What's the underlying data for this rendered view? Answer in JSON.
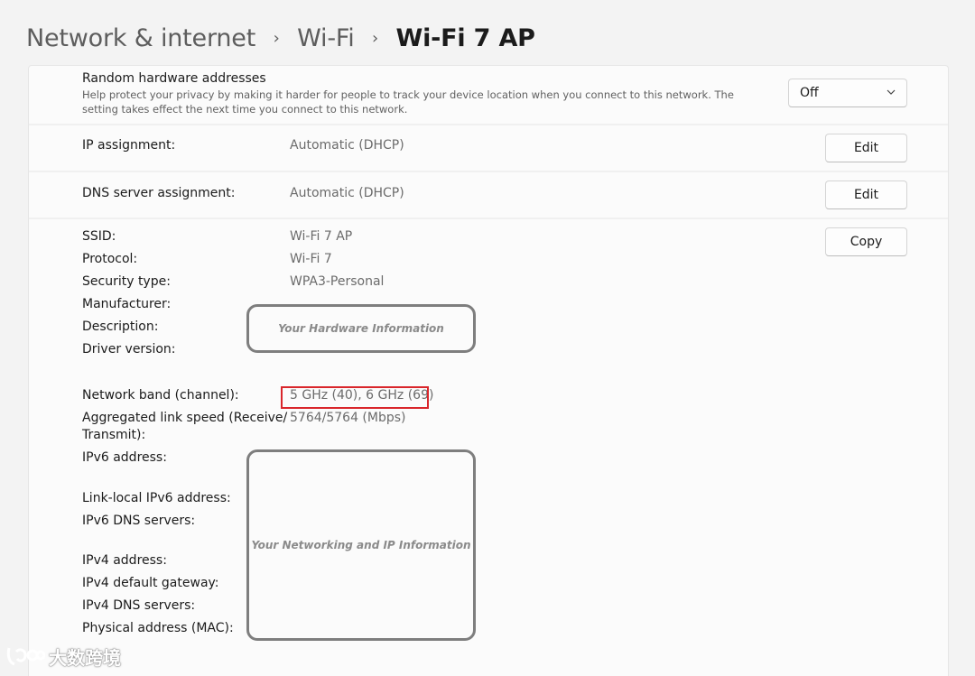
{
  "breadcrumb": {
    "items": [
      "Network & internet",
      "Wi-Fi",
      "Wi-Fi 7 AP"
    ],
    "separator": "›"
  },
  "random_hw": {
    "title": "Random hardware addresses",
    "description": "Help protect your privacy by making it harder for people to track your device location when you connect to this network. The setting takes effect the next time you connect to this network.",
    "selected": "Off",
    "icon": "chevron-down-icon"
  },
  "ip_assignment": {
    "label": "IP assignment:",
    "value": "Automatic (DHCP)",
    "button": "Edit"
  },
  "dns_assignment": {
    "label": "DNS server assignment:",
    "value": "Automatic (DHCP)",
    "button": "Edit"
  },
  "properties": {
    "copy_button": "Copy",
    "ssid": {
      "label": "SSID:",
      "value": "Wi-Fi 7 AP"
    },
    "protocol": {
      "label": "Protocol:",
      "value": "Wi-Fi 7"
    },
    "security": {
      "label": "Security type:",
      "value": "WPA3-Personal"
    },
    "manufacturer": {
      "label": "Manufacturer:"
    },
    "description": {
      "label": "Description:"
    },
    "driver": {
      "label": "Driver version:"
    },
    "band": {
      "label": "Network band (channel):",
      "value": "5 GHz (40), 6 GHz (69)"
    },
    "link_speed": {
      "label_line1": "Aggregated link speed (Receive/",
      "label_line2": "Transmit):",
      "value": "5764/5764 (Mbps)"
    },
    "ipv6": {
      "label": "IPv6 address:"
    },
    "link_local": {
      "label": "Link-local IPv6 address:"
    },
    "ipv6_dns": {
      "label": "IPv6 DNS servers:"
    },
    "ipv4": {
      "label": "IPv4 address:"
    },
    "ipv4_gateway": {
      "label": "IPv4 default gateway:"
    },
    "ipv4_dns": {
      "label": "IPv4 DNS servers:"
    },
    "mac": {
      "label": "Physical address (MAC):"
    }
  },
  "overlays": {
    "hardware_box": "Your Hardware Information",
    "networking_box": "Your Networking and IP Information",
    "highlight_color": "#d9262b"
  },
  "watermark": {
    "text": "大数跨境"
  }
}
